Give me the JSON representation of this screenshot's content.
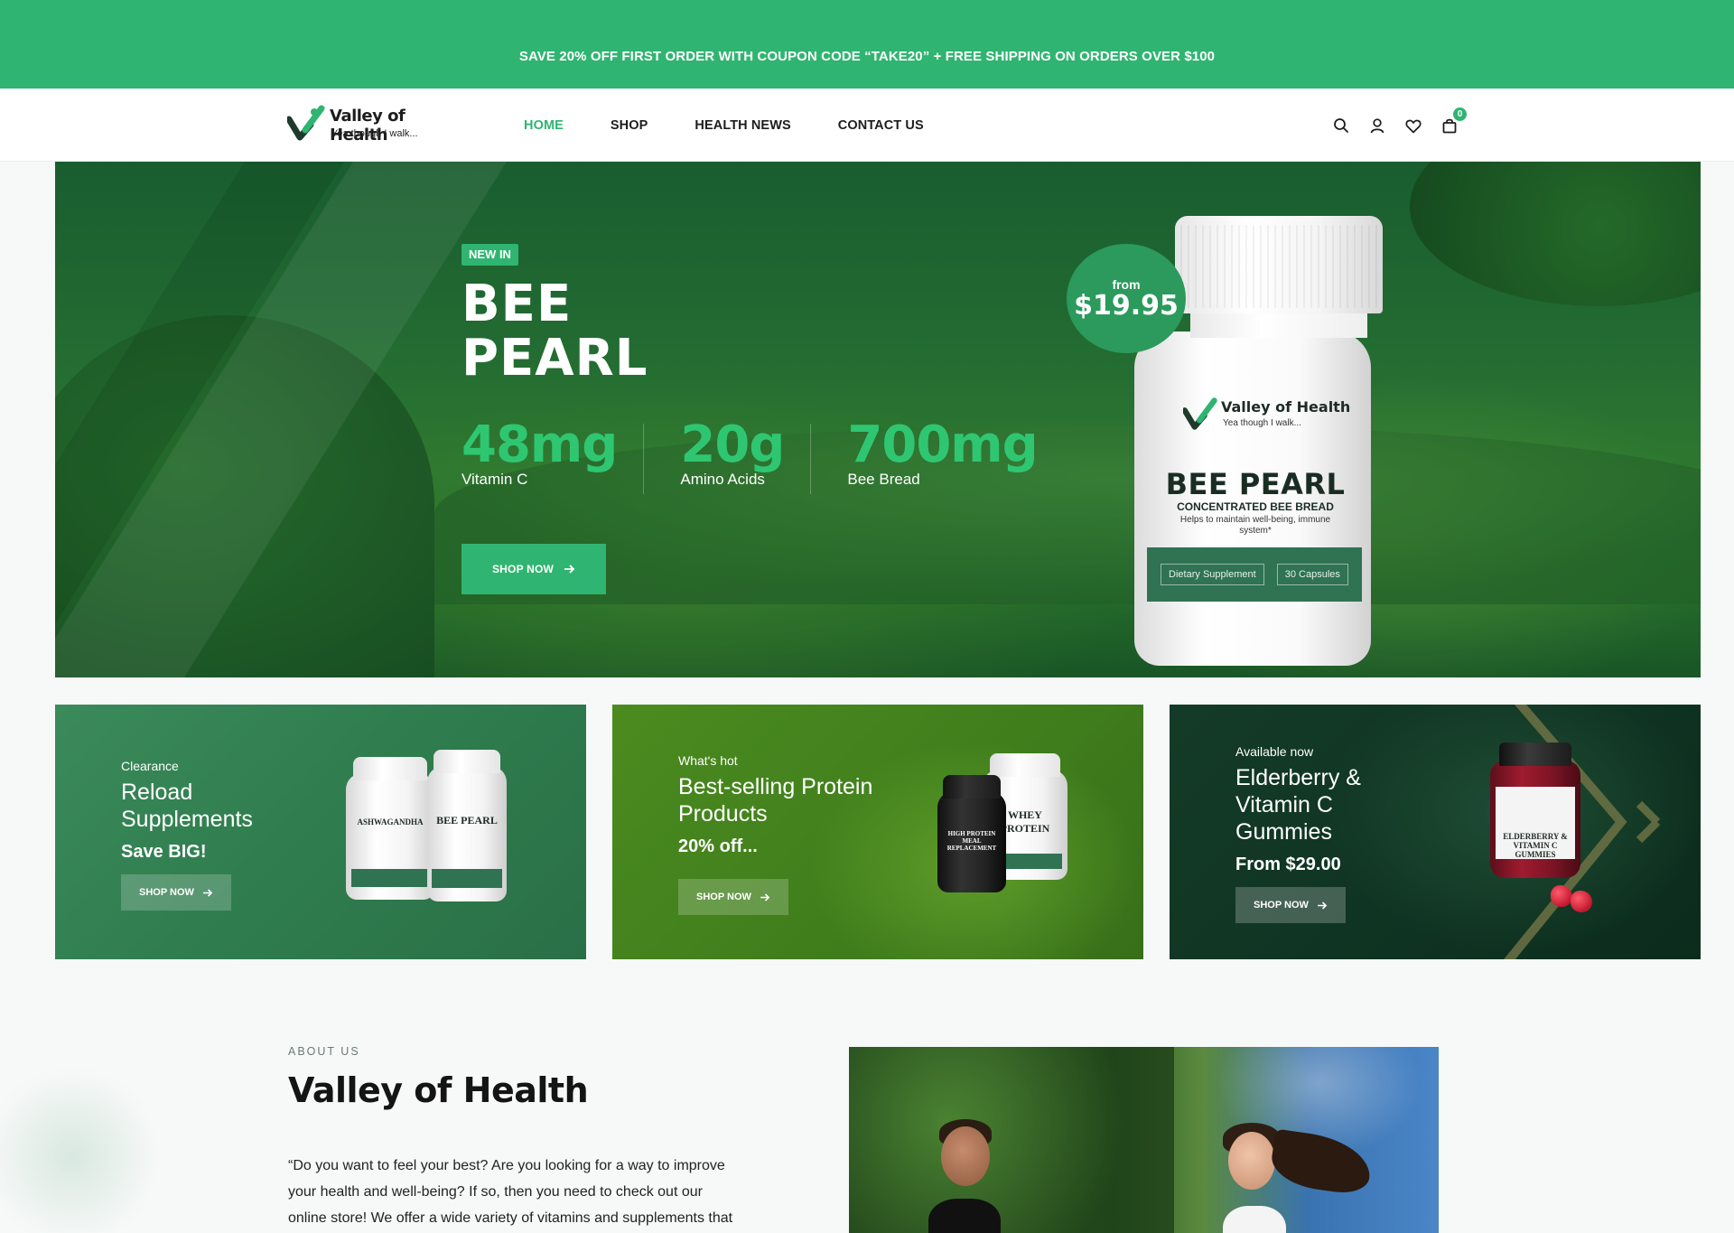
{
  "promo_bar": {
    "text": "SAVE 20% OFF FIRST ORDER WITH COUPON CODE “TAKE20” + FREE SHIPPING ON ORDERS OVER $100"
  },
  "header": {
    "logo_name": "Valley of Health",
    "logo_tagline": "Yea though I walk...",
    "nav": [
      {
        "label": "HOME",
        "active": true
      },
      {
        "label": "SHOP",
        "active": false
      },
      {
        "label": "HEALTH NEWS",
        "active": false
      },
      {
        "label": "CONTACT US",
        "active": false
      }
    ],
    "icons": [
      "search-icon",
      "account-icon",
      "wishlist-heart-icon",
      "cart-bag-icon"
    ],
    "cart_count": "0"
  },
  "hero": {
    "badge": "NEW IN",
    "title_line1": "BEE",
    "title_line2": "PEARL",
    "stats": [
      {
        "value": "48mg",
        "label": "Vitamin C"
      },
      {
        "value": "20g",
        "label": "Amino Acids"
      },
      {
        "value": "700mg",
        "label": "Bee Bread"
      }
    ],
    "button_label": "SHOP NOW",
    "price_from": "from",
    "price": "$19.95",
    "bottle": {
      "brand": "Valley of Health",
      "tagline": "Yea though I walk...",
      "name": "BEE PEARL",
      "subtitle": "CONCENTRATED BEE BREAD",
      "claim": "Helps to maintain well-being, immune system*",
      "tag1": "Dietary Supplement",
      "tag2": "30 Capsules"
    }
  },
  "cards": [
    {
      "eyebrow": "Clearance",
      "heading_line1": "Reload",
      "heading_line2": "Supplements",
      "promo": "Save BIG!",
      "button": "SHOP NOW",
      "jar1": "ASHWAGANDHA",
      "jar2": "BEE PEARL"
    },
    {
      "eyebrow": "What's hot",
      "heading_line1": "Best-selling Protein",
      "heading_line2": "Products",
      "promo": "20% off...",
      "button": "SHOP NOW",
      "jar1": "HIGH PROTEIN MEAL REPLACEMENT",
      "jar2": "WHEY PROTEIN"
    },
    {
      "eyebrow": "Available now",
      "heading_line1": "Elderberry &",
      "heading_line2": "Vitamin C",
      "heading_line3": "Gummies",
      "promo": "From $29.00",
      "button": "SHOP NOW",
      "jar1": "ELDERBERRY & VITAMIN C GUMMIES"
    }
  ],
  "about": {
    "label": "ABOUT US",
    "title": "Valley of Health",
    "line1": "“Do you want to feel your best? Are you looking for a way to improve",
    "line2": "your health and well-being? If so, then you need to check out our",
    "line3": "online store! We offer a wide variety of vitamins and supplements that"
  },
  "colors": {
    "brand_green": "#2fb571",
    "dark_green": "#2f7352",
    "text_dark": "#1d1d1d"
  }
}
